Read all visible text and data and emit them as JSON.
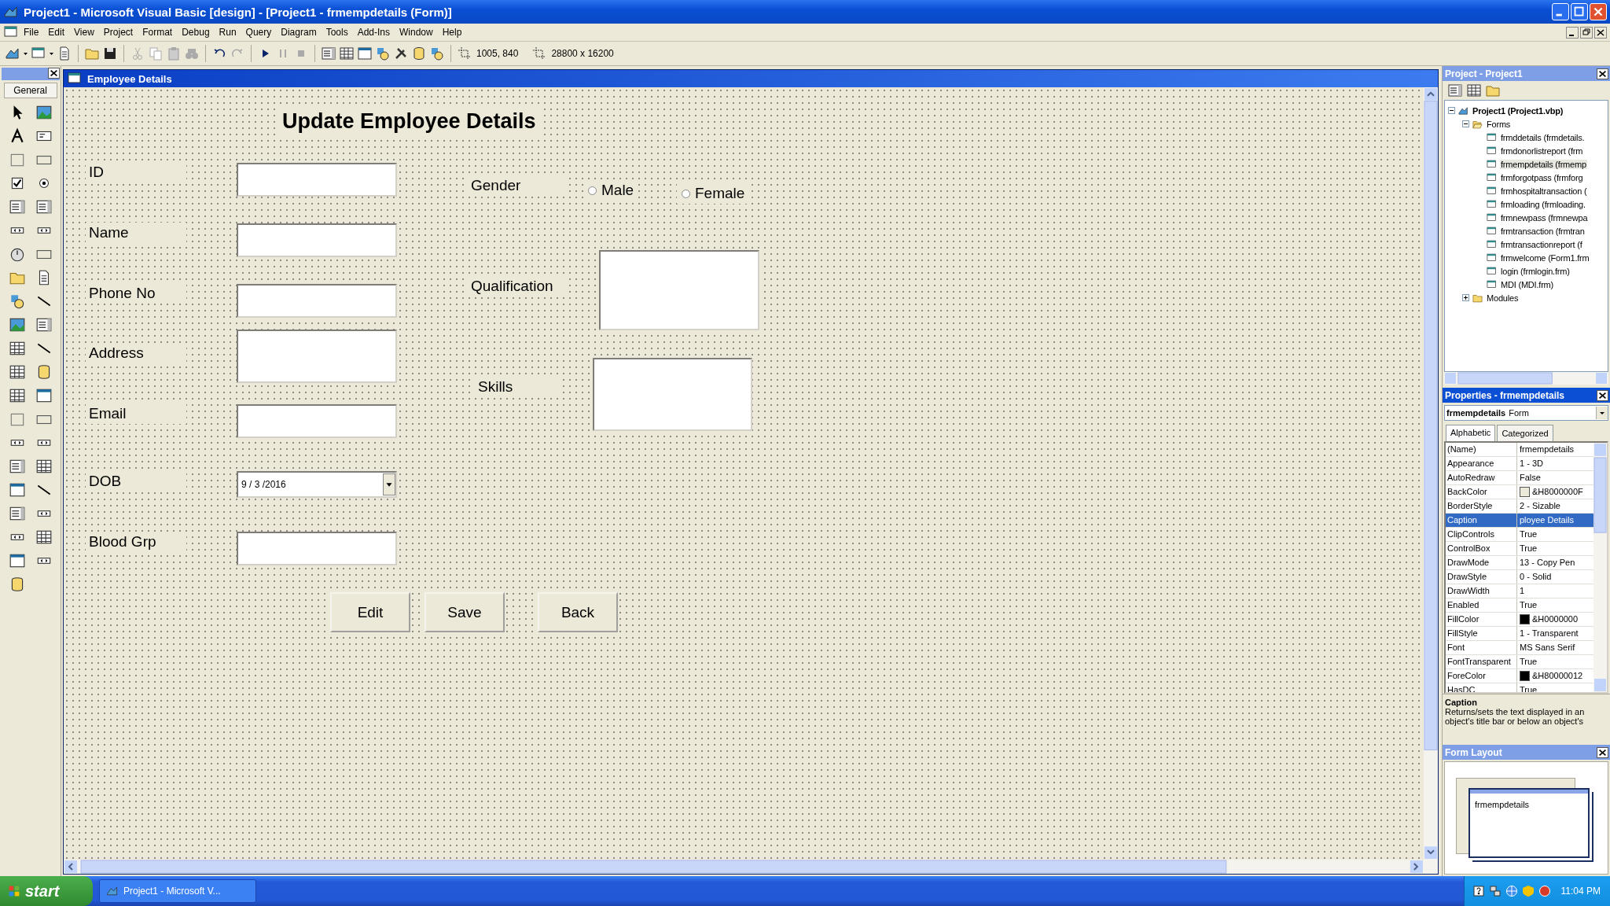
{
  "window": {
    "title": "Project1 - Microsoft Visual Basic [design] - [Project1 - frmempdetails (Form)]"
  },
  "menu": [
    "File",
    "Edit",
    "View",
    "Project",
    "Format",
    "Debug",
    "Run",
    "Query",
    "Diagram",
    "Tools",
    "Add-Ins",
    "Window",
    "Help"
  ],
  "toolbar": {
    "position": "1005, 840",
    "size": "28800 x 16200"
  },
  "toolbox": {
    "title": "General"
  },
  "form": {
    "title": "Employee Details",
    "heading": "Update Employee Details",
    "fields": [
      {
        "kind": "text",
        "label": "ID"
      },
      {
        "kind": "text",
        "label": "Name"
      },
      {
        "kind": "text",
        "label": "Phone No"
      },
      {
        "kind": "multiline",
        "label": "Address"
      },
      {
        "kind": "text",
        "label": "Email"
      },
      {
        "kind": "date",
        "label": "DOB",
        "value": "9 / 3 /2016"
      },
      {
        "kind": "text",
        "label": "Blood Grp"
      }
    ],
    "gender": {
      "label": "Gender",
      "options": [
        {
          "label": "Male",
          "selected": false
        },
        {
          "label": "Female",
          "selected": false
        }
      ]
    },
    "qualification": {
      "label": "Qualification"
    },
    "skills": {
      "label": "Skills"
    },
    "buttons": [
      "Edit",
      "Save",
      "Back"
    ]
  },
  "project": {
    "title": "Project - Project1",
    "tree": {
      "label": "Project1 (Project1.vbp)",
      "kind": "project",
      "expanded": true,
      "selected": false,
      "children": [
        {
          "label": "Forms",
          "kind": "folder",
          "expanded": true,
          "selected": false,
          "children": [
            {
              "label": "frmddetails (frmdetails.",
              "kind": "form",
              "selected": false
            },
            {
              "label": "frmdonorlistreport (frm",
              "kind": "form",
              "selected": false
            },
            {
              "label": "frmempdetails (frmemp",
              "kind": "form",
              "selected": true
            },
            {
              "label": "frmforgotpass (frmforg",
              "kind": "form",
              "selected": false
            },
            {
              "label": "frmhospitaltransaction (",
              "kind": "form",
              "selected": false
            },
            {
              "label": "frmloading (frmloading.",
              "kind": "form",
              "selected": false
            },
            {
              "label": "frmnewpass (frmnewpa",
              "kind": "form",
              "selected": false
            },
            {
              "label": "frmtransaction (frmtran",
              "kind": "form",
              "selected": false
            },
            {
              "label": "frmtransactionreport (f",
              "kind": "form",
              "selected": false
            },
            {
              "label": "frmwelcome (Form1.frm",
              "kind": "form",
              "selected": false
            },
            {
              "label": "login (frmlogin.frm)",
              "kind": "form",
              "selected": false
            },
            {
              "label": "MDI (MDI.frm)",
              "kind": "form",
              "selected": false
            }
          ]
        },
        {
          "label": "Modules",
          "kind": "folder",
          "expanded": false,
          "selected": false
        }
      ]
    }
  },
  "properties": {
    "title": "Properties - frmempdetails",
    "object": "frmempdetails",
    "object_type": "Form",
    "tabs": [
      {
        "label": "Alphabetic",
        "selected": true
      },
      {
        "label": "Categorized",
        "selected": false
      }
    ],
    "rows": [
      {
        "name": "(Name)",
        "value": "frmempdetails",
        "selected": false
      },
      {
        "name": "Appearance",
        "value": "1 - 3D",
        "selected": false
      },
      {
        "name": "AutoRedraw",
        "value": "False",
        "selected": false
      },
      {
        "name": "BackColor",
        "value": "&H8000000F",
        "color": "#ece9d8",
        "selected": false
      },
      {
        "name": "BorderStyle",
        "value": "2 - Sizable",
        "selected": false
      },
      {
        "name": "Caption",
        "value": "ployee Details",
        "selected": true
      },
      {
        "name": "ClipControls",
        "value": "True",
        "selected": false
      },
      {
        "name": "ControlBox",
        "value": "True",
        "selected": false
      },
      {
        "name": "DrawMode",
        "value": "13 - Copy Pen",
        "selected": false
      },
      {
        "name": "DrawStyle",
        "value": "0 - Solid",
        "selected": false
      },
      {
        "name": "DrawWidth",
        "value": "1",
        "selected": false
      },
      {
        "name": "Enabled",
        "value": "True",
        "selected": false
      },
      {
        "name": "FillColor",
        "value": "&H0000000",
        "color": "#000000",
        "selected": false
      },
      {
        "name": "FillStyle",
        "value": "1 - Transparent",
        "selected": false
      },
      {
        "name": "Font",
        "value": "MS Sans Serif",
        "selected": false
      },
      {
        "name": "FontTransparent",
        "value": "True",
        "selected": false
      },
      {
        "name": "ForeColor",
        "value": "&H80000012",
        "color": "#000000",
        "selected": false
      },
      {
        "name": "HasDC",
        "value": "True",
        "selected": false
      }
    ],
    "description_title": "Caption",
    "description": "Returns/sets the text displayed in an object's title bar or below an object's"
  },
  "form_layout": {
    "title": "Form Layout",
    "form_name": "frmempdetails"
  },
  "taskbar": {
    "start": "start",
    "tasks": [
      "Project1 - Microsoft V..."
    ],
    "clock": "11:04 PM"
  }
}
